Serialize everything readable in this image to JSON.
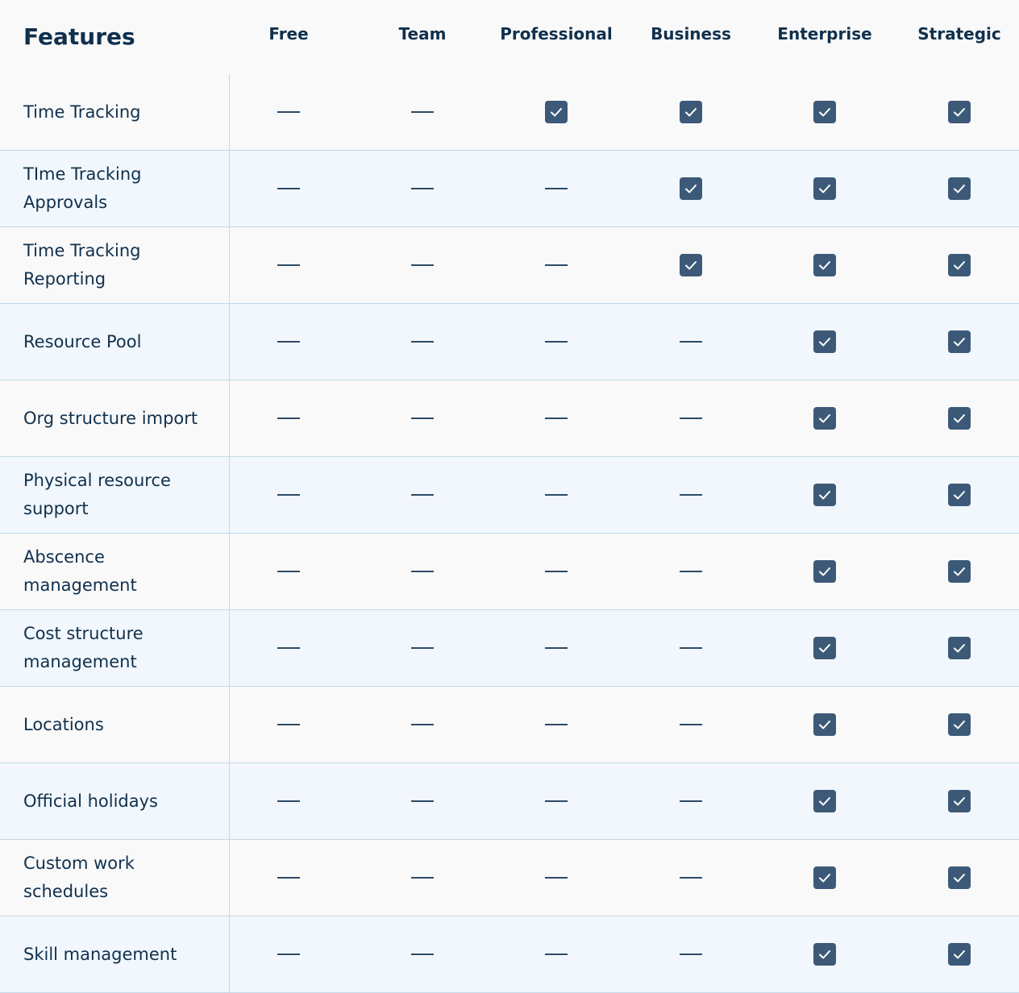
{
  "title": "Features",
  "plans": [
    "Free",
    "Team",
    "Professional",
    "Business",
    "Enterprise",
    "Strategic"
  ],
  "colors": {
    "text": "#10304d",
    "check_fill": "#3c5a78",
    "row_alt": "#f1f7fc",
    "row_plain": "#f9f9f9",
    "border": "#c5d9e8"
  },
  "icons": {
    "included": "checkbox-checked-icon",
    "excluded": "dash-icon"
  },
  "rows": [
    {
      "label": "Time Tracking",
      "values": [
        false,
        false,
        true,
        true,
        true,
        true
      ]
    },
    {
      "label": "TIme Tracking Approvals",
      "values": [
        false,
        false,
        false,
        true,
        true,
        true
      ]
    },
    {
      "label": "Time Tracking Reporting",
      "values": [
        false,
        false,
        false,
        true,
        true,
        true
      ]
    },
    {
      "label": "Resource Pool",
      "values": [
        false,
        false,
        false,
        false,
        true,
        true
      ]
    },
    {
      "label": "Org structure import",
      "values": [
        false,
        false,
        false,
        false,
        true,
        true
      ]
    },
    {
      "label": "Physical resource support",
      "values": [
        false,
        false,
        false,
        false,
        true,
        true
      ]
    },
    {
      "label": "Abscence management",
      "values": [
        false,
        false,
        false,
        false,
        true,
        true
      ]
    },
    {
      "label": "Cost structure management",
      "values": [
        false,
        false,
        false,
        false,
        true,
        true
      ]
    },
    {
      "label": "Locations",
      "values": [
        false,
        false,
        false,
        false,
        true,
        true
      ]
    },
    {
      "label": "Official holidays",
      "values": [
        false,
        false,
        false,
        false,
        true,
        true
      ]
    },
    {
      "label": "Custom work schedules",
      "values": [
        false,
        false,
        false,
        false,
        true,
        true
      ]
    },
    {
      "label": "Skill management",
      "values": [
        false,
        false,
        false,
        false,
        true,
        true
      ]
    }
  ]
}
